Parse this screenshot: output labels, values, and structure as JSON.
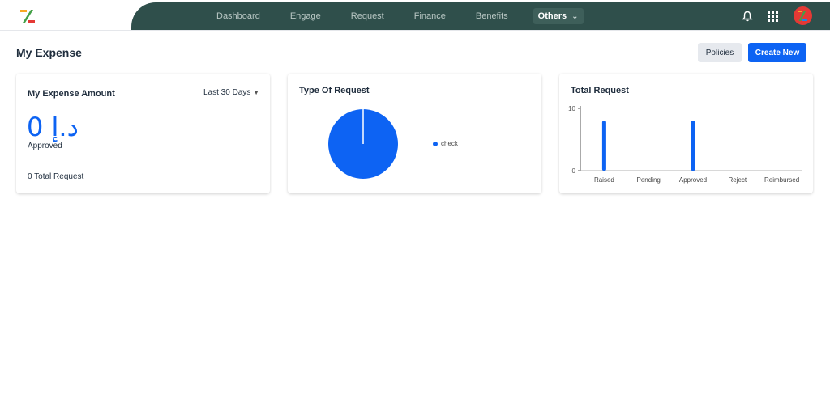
{
  "nav": {
    "items": [
      "Dashboard",
      "Engage",
      "Request",
      "Finance",
      "Benefits"
    ],
    "active": "Others"
  },
  "colors": {
    "accent": "#0d63f3",
    "header": "#2f4f4b",
    "avatar": "#e53935"
  },
  "page": {
    "title": "My Expense",
    "policies_label": "Policies",
    "create_label": "Create New"
  },
  "expense_card": {
    "title": "My Expense Amount",
    "range": "Last 30 Days",
    "amount": "0 د.إ",
    "status": "Approved",
    "total": "0 Total Request"
  },
  "type_card": {
    "title": "Type Of Request"
  },
  "total_card": {
    "title": "Total Request"
  },
  "chart_data": [
    {
      "type": "pie",
      "title": "Type Of Request",
      "categories": [
        "check"
      ],
      "values": [
        1
      ],
      "legend": "right"
    },
    {
      "type": "bar",
      "title": "Total Request",
      "categories": [
        "Raised",
        "Pending",
        "Approved",
        "Reject",
        "Reimbursed"
      ],
      "values": [
        8,
        0,
        8,
        0,
        0
      ],
      "yticks": [
        "10",
        "0"
      ],
      "ylim": [
        0,
        10
      ]
    }
  ]
}
